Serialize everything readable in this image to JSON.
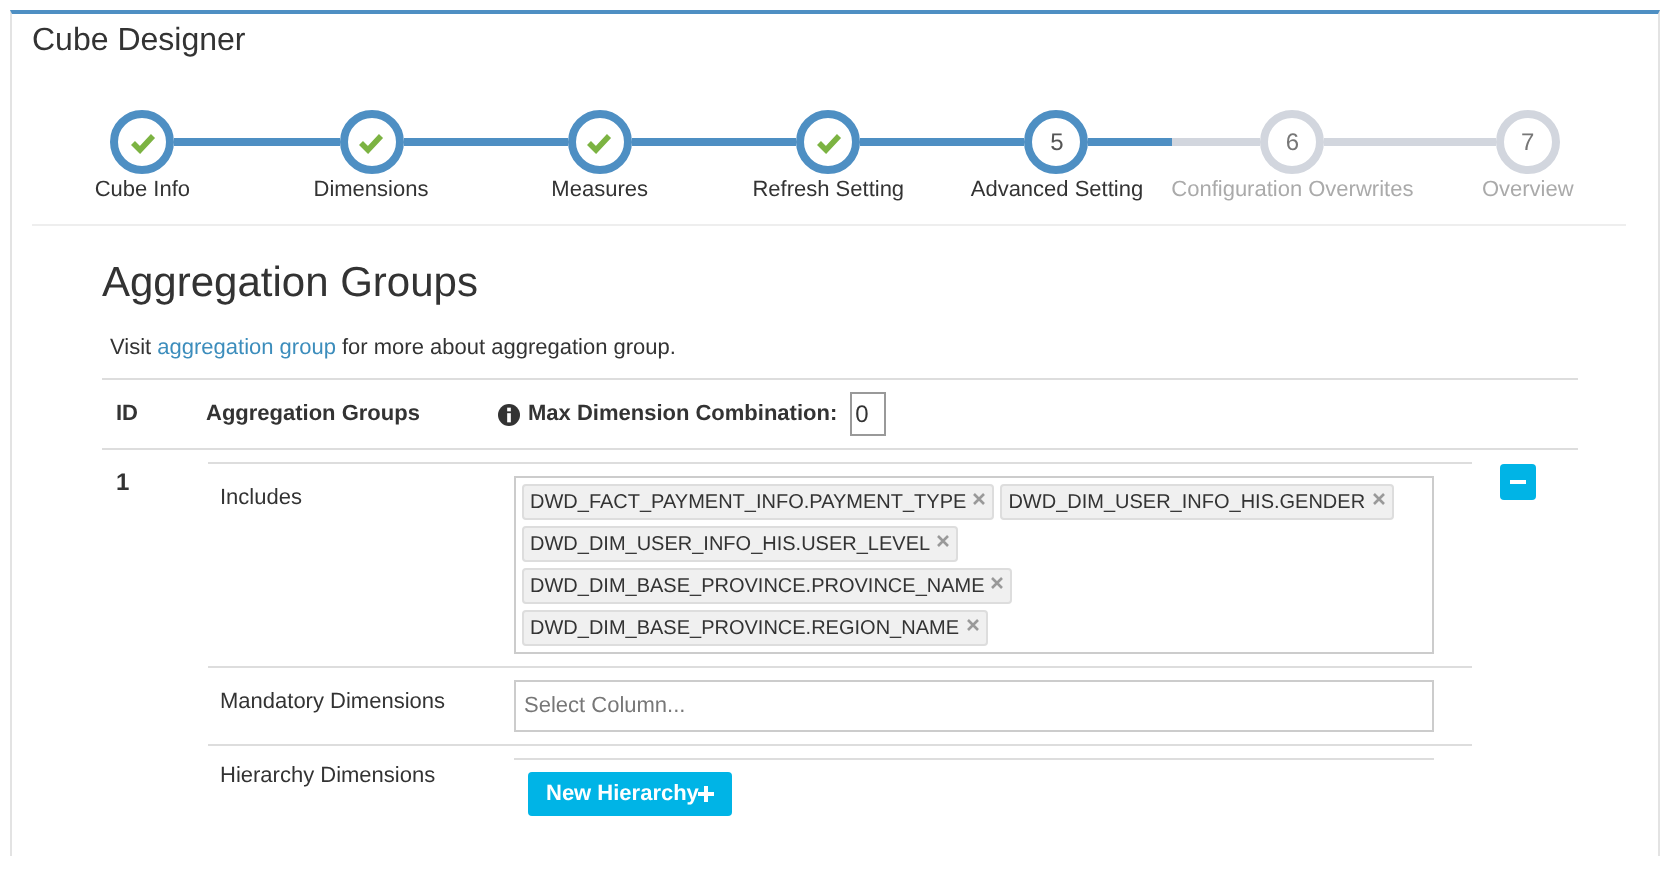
{
  "title": "Cube Designer",
  "steps": [
    {
      "label": "Cube Info",
      "kind": "done"
    },
    {
      "label": "Dimensions",
      "kind": "done"
    },
    {
      "label": "Measures",
      "kind": "done"
    },
    {
      "label": "Refresh Setting",
      "kind": "done"
    },
    {
      "label": "Advanced Setting",
      "number": "5",
      "kind": "current"
    },
    {
      "label": "Configuration Overwrites",
      "number": "6",
      "kind": "pending"
    },
    {
      "label": "Overview",
      "number": "7",
      "kind": "pending"
    }
  ],
  "section": {
    "heading": "Aggregation Groups",
    "intro_before": "Visit ",
    "intro_link": "aggregation group",
    "intro_after": " for more about aggregation group."
  },
  "table": {
    "columns": [
      "ID",
      "Aggregation Groups"
    ],
    "max_label": "Max Dimension Combination:",
    "max_value": "0",
    "rows": [
      {
        "group_number": "1",
        "includes_label": "Includes",
        "includes": [
          "DWD_FACT_PAYMENT_INFO.PAYMENT_TYPE",
          "DWD_DIM_USER_INFO_HIS.GENDER",
          "DWD_DIM_USER_INFO_HIS.USER_LEVEL",
          "DWD_DIM_BASE_PROVINCE.PROVINCE_NAME",
          "DWD_DIM_BASE_PROVINCE.REGION_NAME"
        ],
        "mandatory_label": "Mandatory Dimensions",
        "mandatory_placeholder": "Select Column...",
        "hierarchy_label": "Hierarchy Dimensions",
        "hierarchy_button": "New Hierarchy"
      }
    ]
  }
}
